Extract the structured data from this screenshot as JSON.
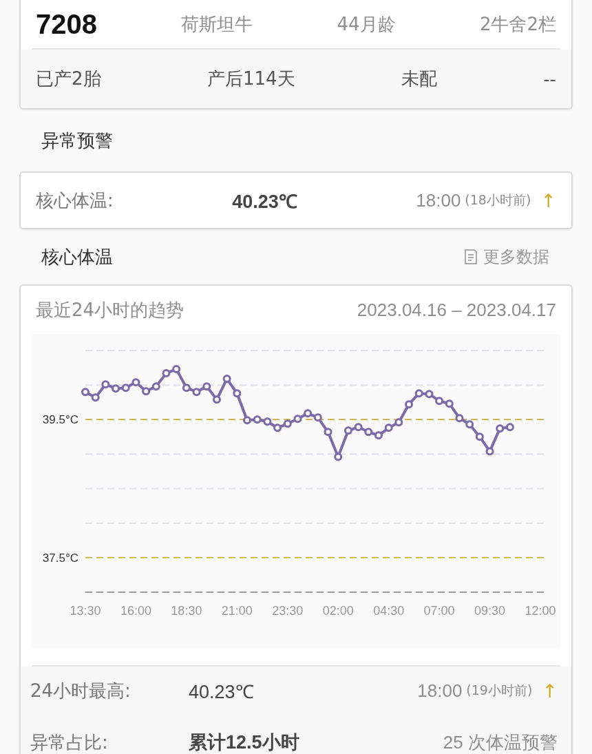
{
  "cow": {
    "id": "7208",
    "breed": "荷斯坦牛",
    "age": "44月龄",
    "pen": "2牛舍2栏",
    "parity": "已产2胎",
    "days_postpartum": "产后114天",
    "breeding_status": "未配",
    "column_4": "--"
  },
  "alert": {
    "title": "异常预警",
    "label": "核心体温:",
    "value": "40.23℃",
    "time": "18:00",
    "ago": "(18小时前)",
    "arrow": "↑"
  },
  "trend": {
    "title": "核心体温",
    "more_link": "更多数据",
    "card_title": "最近24小时的趋势",
    "date_range": "2023.04.16 – 2023.04.17",
    "chart_data": {
      "type": "line",
      "categories": [
        "13:30",
        null,
        null,
        null,
        null,
        "16:00",
        null,
        null,
        null,
        null,
        "18:30",
        null,
        null,
        null,
        null,
        "21:00",
        null,
        null,
        null,
        null,
        "23:30",
        null,
        null,
        null,
        null,
        "02:00",
        null,
        null,
        null,
        null,
        "04:30",
        null,
        null,
        null,
        null,
        "07:00",
        null,
        null,
        null,
        null,
        "09:30",
        null,
        null,
        null,
        null,
        "12:00"
      ],
      "series": [
        {
          "color": "#7b6ba8",
          "marker": "circle",
          "values": [
            39.9,
            39.82,
            40.01,
            39.95,
            39.96,
            40.04,
            39.91,
            39.98,
            40.17,
            40.23,
            39.96,
            39.9,
            39.98,
            39.79,
            40.09,
            39.88,
            39.49,
            39.5,
            39.47,
            39.38,
            39.44,
            39.51,
            39.59,
            39.53,
            39.32,
            38.96,
            39.34,
            39.39,
            39.32,
            39.27,
            39.38,
            39.46,
            39.72,
            39.88,
            39.87,
            39.77,
            39.73,
            39.52,
            39.43,
            39.25,
            39.04,
            39.37,
            39.39,
            null,
            null,
            null
          ]
        }
      ],
      "ylim": [
        37,
        40.5
      ],
      "yticks": [
        {
          "value": 37.5,
          "label": "37.5°C"
        },
        {
          "value": 39.5,
          "label": "39.5°C"
        }
      ]
    },
    "stats": [
      {
        "kind": "peak",
        "label": "24小时最高:",
        "value": "40.23℃",
        "time": "18:00",
        "ago": "(19小时前)",
        "arrow": "↑"
      },
      {
        "kind": "count",
        "label": "异常占比:",
        "value": "累计12.5小时",
        "note": "25 次体温预警"
      }
    ]
  }
}
